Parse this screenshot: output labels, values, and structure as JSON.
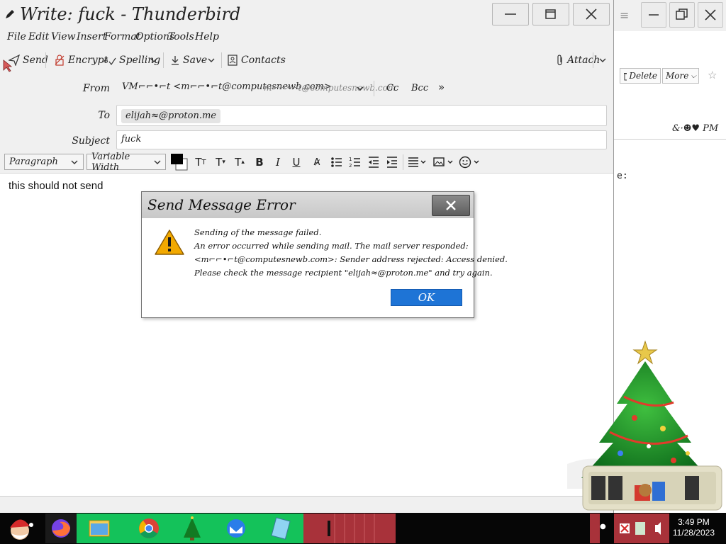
{
  "compose": {
    "title": "Write: fuck - Thunderbird",
    "menu": [
      "File",
      "Edit",
      "View",
      "Insert",
      "Format",
      "Options",
      "Tools",
      "Help"
    ],
    "toolbar": {
      "send": "Send",
      "encrypt": "Encrypt",
      "spelling": "Spelling",
      "save": "Save",
      "contacts": "Contacts",
      "attach": "Attach"
    },
    "headers": {
      "from_label": "From",
      "from_value": "VM⌐⌐•⌐t <m⌐⌐•⌐t@computesnewb.com>",
      "from_alt": "m⌐⌐•⌐t@computesnewb.com",
      "cc": "Cc",
      "bcc": "Bcc",
      "to_label": "To",
      "to_value": "elijah≈@proton.me",
      "subject_label": "Subject",
      "subject_value": "fuck"
    },
    "format": {
      "paragraph": "Paragraph",
      "font": "Variable Width"
    },
    "body_text": "this should not send"
  },
  "background_window": {
    "delete": "Delete",
    "more": "More",
    "sender_fragment": "&·☻♥ PM",
    "fragment": "e:"
  },
  "dialog": {
    "title": "Send Message Error",
    "lines": [
      "Sending of the message failed.",
      "An error occurred while sending mail. The mail server responded:",
      "<m⌐⌐•⌐t@computesnewb.com>: Sender address rejected: Access denied.",
      "Please check the message recipient \"elijah≈@proton.me\" and try again."
    ],
    "ok": "OK"
  },
  "taskbar": {
    "time": "3:49 PM",
    "date": "11/28/2023"
  },
  "colors": {
    "accent": "#1e74d6",
    "warning": "#f2a900",
    "taskbar": "#060606",
    "chrome": "#f0f0f0"
  }
}
